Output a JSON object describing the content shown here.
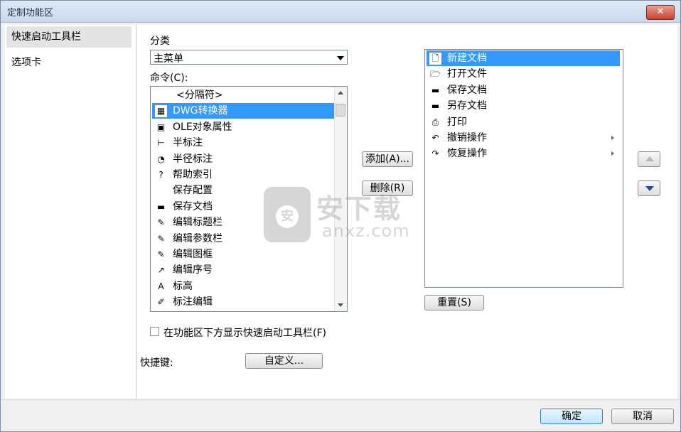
{
  "window": {
    "title": "定制功能区",
    "close_symbol": "✕"
  },
  "nav": {
    "items": [
      {
        "label": "快速启动工具栏",
        "selected": true
      },
      {
        "label": "选项卡",
        "selected": false
      }
    ]
  },
  "category": {
    "label": "分类",
    "value": "主菜单"
  },
  "commands": {
    "label": "命令(C):",
    "items": [
      {
        "label": "<分隔符>",
        "icon": "none",
        "glyph": ""
      },
      {
        "label": "DWG转换器",
        "icon": "dwg-converter-icon",
        "glyph": "▦"
      },
      {
        "label": "OLE对象属性",
        "icon": "ole-object-icon",
        "glyph": "▣"
      },
      {
        "label": "半标注",
        "icon": "half-dimension-icon",
        "glyph": "⊢"
      },
      {
        "label": "半径标注",
        "icon": "radius-dimension-icon",
        "glyph": "◔"
      },
      {
        "label": "帮助索引",
        "icon": "help-icon",
        "glyph": "?"
      },
      {
        "label": "保存配置",
        "icon": "none",
        "glyph": ""
      },
      {
        "label": "保存文档",
        "icon": "save-icon",
        "glyph": "▬"
      },
      {
        "label": "编辑标题栏",
        "icon": "edit-titlebar-icon",
        "glyph": "✎"
      },
      {
        "label": "编辑参数栏",
        "icon": "edit-params-icon",
        "glyph": "✎"
      },
      {
        "label": "编辑图框",
        "icon": "edit-frame-icon",
        "glyph": "✎"
      },
      {
        "label": "编辑序号",
        "icon": "edit-number-icon",
        "glyph": "↗"
      },
      {
        "label": "标高",
        "icon": "elevation-icon",
        "glyph": "A"
      },
      {
        "label": "标注编辑",
        "icon": "dimension-edit-icon",
        "glyph": "✐"
      }
    ]
  },
  "buttons": {
    "add": "添加(A)...",
    "remove": "删除(R)",
    "reset": "重置(S)",
    "customize": "自定义...",
    "ok": "确定",
    "cancel": "取消"
  },
  "toolbar_list": {
    "items": [
      {
        "label": "新建文档",
        "icon": "new-document-icon",
        "glyph": "🗋",
        "submenu": false
      },
      {
        "label": "打开文件",
        "icon": "open-folder-icon",
        "glyph": "🗁",
        "submenu": false
      },
      {
        "label": "保存文档",
        "icon": "save-icon",
        "glyph": "▬",
        "submenu": false
      },
      {
        "label": "另存文档",
        "icon": "save-as-icon",
        "glyph": "▬",
        "submenu": false
      },
      {
        "label": "打印",
        "icon": "printer-icon",
        "glyph": "⎙",
        "submenu": false
      },
      {
        "label": "撤销操作",
        "icon": "undo-icon",
        "glyph": "↶",
        "submenu": true
      },
      {
        "label": "恢复操作",
        "icon": "redo-icon",
        "glyph": "↷",
        "submenu": true
      }
    ]
  },
  "options": {
    "show_below_label": "在功能区下方显示快速启动工具栏(F)",
    "show_below_checked": false,
    "shortcut_label": "快捷键:"
  },
  "watermark": {
    "title": "安下载",
    "sub": "anxz.com",
    "glyph": "安"
  },
  "colors": {
    "selection": "#3399ff",
    "close": "#c8412c"
  }
}
